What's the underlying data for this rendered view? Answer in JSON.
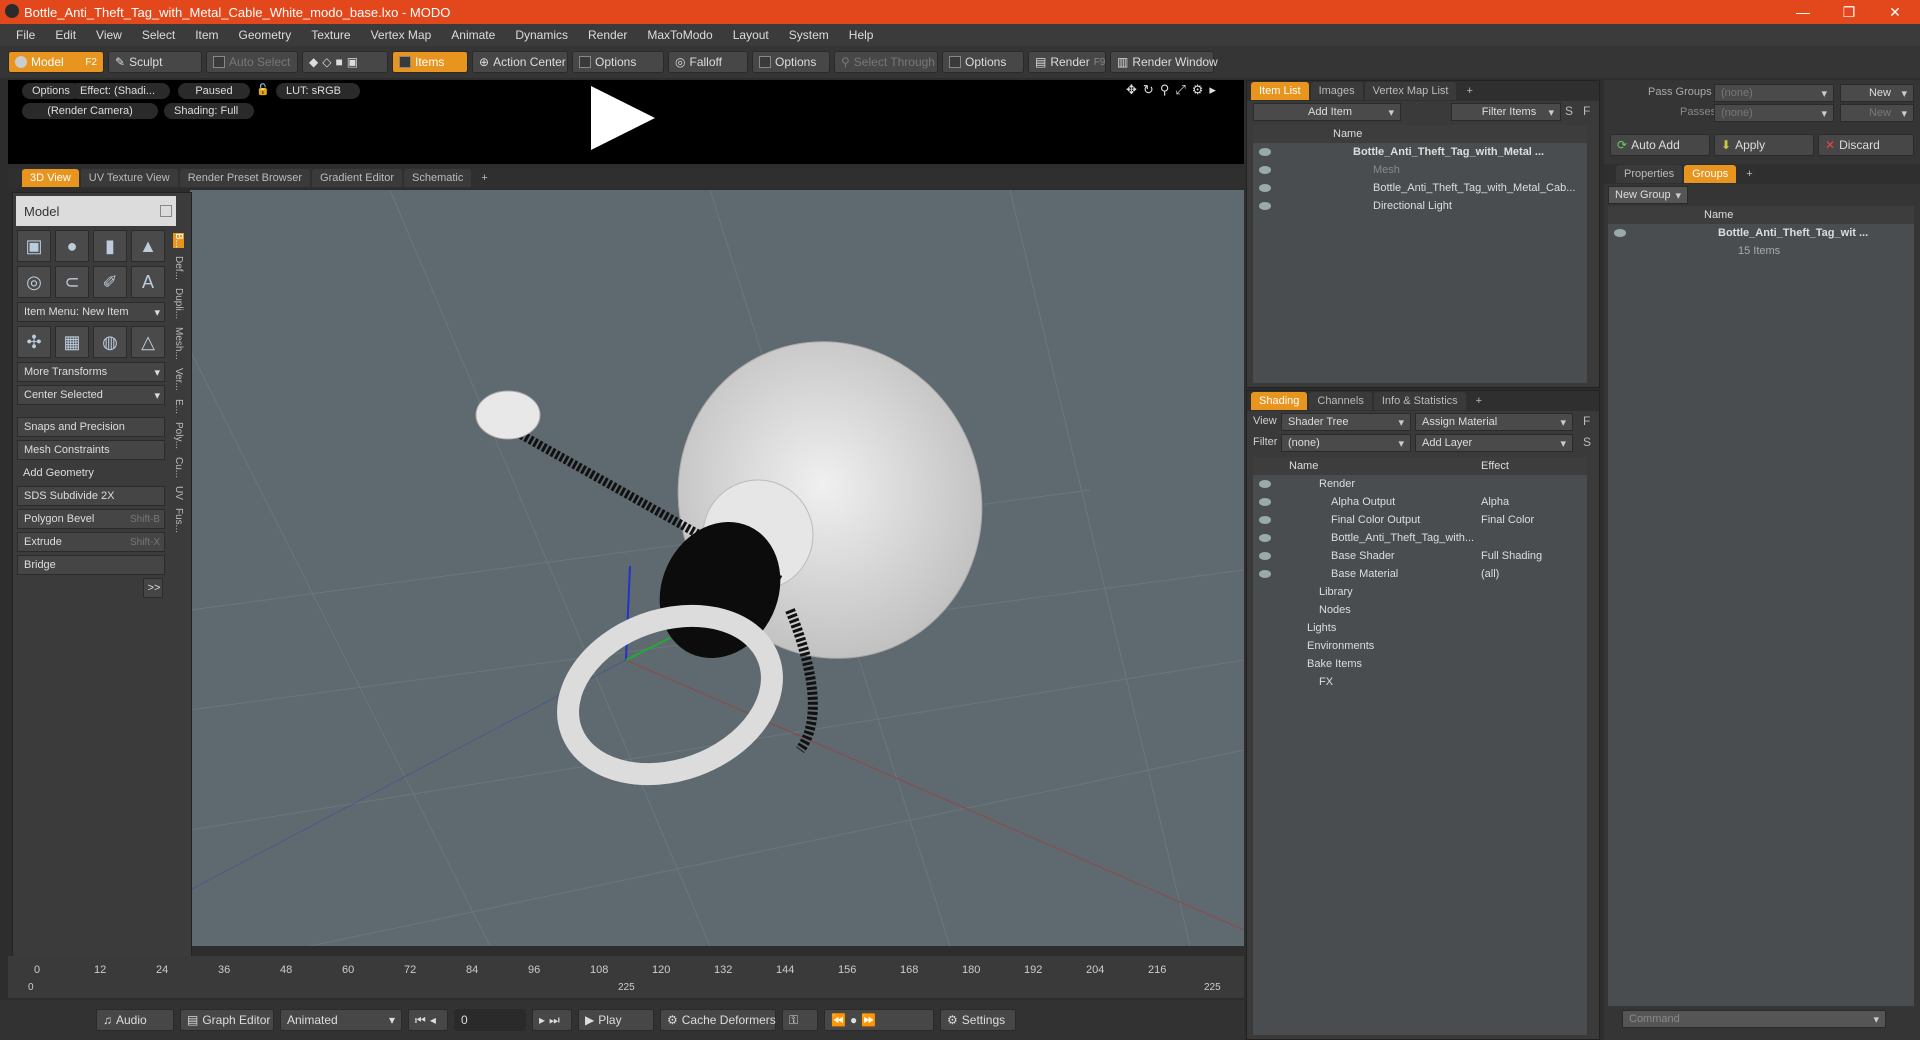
{
  "window": {
    "title": "Bottle_Anti_Theft_Tag_with_Metal_Cable_White_modo_base.lxo - MODO",
    "minimize": "—",
    "restore": "❐",
    "close": "✕"
  },
  "menu": [
    "File",
    "Edit",
    "View",
    "Select",
    "Item",
    "Geometry",
    "Texture",
    "Vertex Map",
    "Animate",
    "Dynamics",
    "Render",
    "MaxToModo",
    "Layout",
    "System",
    "Help"
  ],
  "toolbar": {
    "model": "Model",
    "model_key": "F2",
    "sculpt": "Sculpt",
    "auto_select": "Auto Select",
    "items": "Items",
    "action_center": "Action Center",
    "options1": "Options",
    "falloff": "Falloff",
    "options2": "Options",
    "select_through": "Select Through",
    "options3": "Options",
    "render": "Render",
    "render_key": "F9",
    "render_window": "Render Window"
  },
  "preview": {
    "options": "Options",
    "effect": "Effect: (Shadi...",
    "paused": "Paused",
    "lut": "LUT: sRGB",
    "camera": "(Render Camera)",
    "shading": "Shading: Full"
  },
  "view_tabs": [
    "3D View",
    "UV Texture View",
    "Render Preset Browser",
    "Gradient Editor",
    "Schematic",
    "+"
  ],
  "toolpanel": {
    "header": "Model",
    "item_menu": "Item Menu: New Item",
    "more_transforms": "More Transforms",
    "center_selected": "Center Selected",
    "snaps": "Snaps and Precision",
    "mesh_constraints": "Mesh Constraints",
    "add_geometry": "Add Geometry",
    "sds": "SDS Subdivide 2X",
    "polygon_bevel": "Polygon Bevel",
    "polygon_bevel_key": "Shift-B",
    "extrude": "Extrude",
    "extrude_key": "Shift-X",
    "bridge": "Bridge",
    "more": ">>",
    "side_tabs": [
      "B...",
      "Def...",
      "Dupli...",
      "Mesh...",
      "Ver...",
      "E...",
      "Poly...",
      "Cu...",
      "UV",
      "Fus..."
    ]
  },
  "timeline": {
    "ticks": [
      "0",
      "12",
      "24",
      "36",
      "48",
      "60",
      "72",
      "84",
      "96",
      "108",
      "120",
      "132",
      "144",
      "156",
      "168",
      "180",
      "192",
      "204",
      "216"
    ],
    "start": "0",
    "mid": "225",
    "end": "225"
  },
  "bottombar": {
    "audio": "Audio",
    "graph_editor": "Graph Editor",
    "animated": "Animated",
    "frame": "0",
    "play": "Play",
    "cache_deformers": "Cache Deformers",
    "settings": "Settings"
  },
  "item_list": {
    "tabs": [
      "Item List",
      "Images",
      "Vertex Map List",
      "+"
    ],
    "add_item": "Add Item",
    "filter_items": "Filter Items",
    "s": "S",
    "f": "F",
    "col_name": "Name",
    "rows": [
      "Bottle_Anti_Theft_Tag_with_Metal ...",
      "Mesh",
      "Bottle_Anti_Theft_Tag_with_Metal_Cab...",
      "Directional Light"
    ]
  },
  "shading": {
    "tabs": [
      "Shading",
      "Channels",
      "Info & Statistics",
      "+"
    ],
    "view_label": "View",
    "view_value": "Shader Tree",
    "assign_material": "Assign Material",
    "f": "F",
    "filter_label": "Filter",
    "filter_value": "(none)",
    "add_layer": "Add Layer",
    "s": "S",
    "col_name": "Name",
    "col_effect": "Effect",
    "rows": [
      {
        "name": "Render",
        "effect": ""
      },
      {
        "name": "Alpha Output",
        "effect": "Alpha"
      },
      {
        "name": "Final Color Output",
        "effect": "Final Color"
      },
      {
        "name": "Bottle_Anti_Theft_Tag_with...",
        "effect": ""
      },
      {
        "name": "Base Shader",
        "effect": "Full Shading"
      },
      {
        "name": "Base Material",
        "effect": "(all)"
      },
      {
        "name": "Library",
        "effect": ""
      },
      {
        "name": "Nodes",
        "effect": ""
      },
      {
        "name": "Lights",
        "effect": ""
      },
      {
        "name": "Environments",
        "effect": ""
      },
      {
        "name": "Bake Items",
        "effect": ""
      },
      {
        "name": "FX",
        "effect": ""
      }
    ]
  },
  "right": {
    "pass_groups": "Pass Groups",
    "pass_groups_value": "(none)",
    "new": "New",
    "passes": "Passes",
    "passes_value": "(none)",
    "new2": "New",
    "auto_add": "Auto Add",
    "apply": "Apply",
    "discard": "Discard",
    "tabs": [
      "Properties",
      "Groups",
      "+"
    ],
    "new_group": "New Group",
    "col_name": "Name",
    "group_name": "Bottle_Anti_Theft_Tag_wit ...",
    "group_count": "15 Items",
    "command": "Command"
  },
  "colors": {
    "accent": "#e8951f",
    "title": "#e2481c",
    "viewport": "#5f6a70"
  }
}
